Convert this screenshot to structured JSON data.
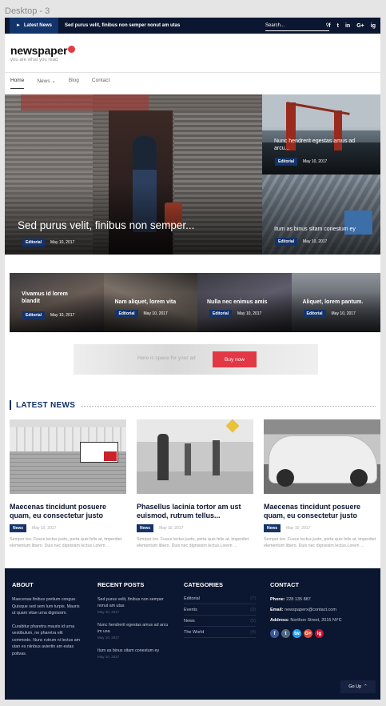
{
  "frame": {
    "label": "Desktop - 3"
  },
  "topbar": {
    "badge_label": "Latest News",
    "ticker": "Sed purus velit, finibus non semper nonut am utas",
    "search_placeholder": "Search...",
    "socials": [
      "f",
      "t",
      "in",
      "G+",
      "ig"
    ]
  },
  "logo": {
    "name": "newspaper",
    "tagline": "you are what you read"
  },
  "nav": {
    "items": [
      "Home",
      "News",
      "Blog",
      "Contact"
    ]
  },
  "hero": {
    "main": {
      "title": "Sed purus velit, finibus non semper...",
      "category": "Editorial",
      "date": "May 10, 2017"
    },
    "side": [
      {
        "title": "Nunc hendrerit egestas amus ad arcu...",
        "category": "Editorial",
        "date": "May 10, 2017"
      },
      {
        "title": "Itum as binus sitam conestum ey",
        "category": "Editorial",
        "date": "May 10, 2017"
      }
    ]
  },
  "strip": [
    {
      "title": "Vivamus id lorem blandit",
      "category": "Editorial",
      "date": "May 10, 2017"
    },
    {
      "title": "Nam aliquet, lorem vita",
      "category": "Editorial",
      "date": "May 10, 2017"
    },
    {
      "title": "Nulla nec enimus amis",
      "category": "Editorial",
      "date": "May 10, 2017"
    },
    {
      "title": "Aliquet, lorem pantum.",
      "category": "Editorial",
      "date": "May 10, 2017"
    }
  ],
  "ad": {
    "text": "Here is space for your ad",
    "button": "Buy now"
  },
  "latest": {
    "heading": "LATEST NEWS",
    "cards": [
      {
        "title": "Maecenas tincidunt posuere quam, eu consectetur justo",
        "category": "News",
        "date": "May 10, 2017",
        "excerpt": "Semper leo. Fusce lectus justo, porta quis felis at, imperdiet elementum libero. Duis nec dignissim lectus.Lorem ..."
      },
      {
        "title": "Phasellus lacinia tortor am ust euismod, rutrum tellus...",
        "category": "News",
        "date": "May 10, 2017",
        "excerpt": "Semper leo. Fusce lectus justo, porta quis felis at, imperdiet elementum libero. Duis nec dignissim lectus.Lorem ..."
      },
      {
        "title": "Maecenas tincidunt posuere quam, eu consectetur justo",
        "category": "News",
        "date": "May 10, 2017",
        "excerpt": "Semper leo. Fusce lectus justo, porta quis felis at, imperdiet elementum libero. Duis nec dignissim lectus.Lorem ..."
      }
    ]
  },
  "footer": {
    "about": {
      "heading": "ABOUT",
      "p1": "Maecenas finibus pretium congue. Quisque sed sem lum turpis. Mauris ut quam vitae urna dignissim.",
      "p2": "Curabitur pharetra mauris id urna vestibulum, ne pharetra elit commodo. Nunc rutrum ni lectus am utan es niinbus aviertin am estas potivas."
    },
    "recent": {
      "heading": "RECENT POSTS",
      "posts": [
        {
          "title": "Sed purus velit, finibus non semper nonut am utas",
          "date": "May 10, 2017"
        },
        {
          "title": "Nunc hendrerit egestas amus ad arcu im usa",
          "date": "May 10, 2017"
        },
        {
          "title": "Itum as binus sitam conestum ey",
          "date": "May 10, 2017"
        }
      ]
    },
    "categories": {
      "heading": "CATEGORIES",
      "items": [
        {
          "name": "Editorial",
          "count": "(7)"
        },
        {
          "name": "Events",
          "count": "(3)"
        },
        {
          "name": "News",
          "count": "(5)"
        },
        {
          "name": "The World",
          "count": "(4)"
        }
      ]
    },
    "contact": {
      "heading": "CONTACT",
      "phone_label": "Phone:",
      "phone": "228 135 887",
      "email_label": "Email:",
      "email": "newspaperx@contact.com",
      "address_label": "Address:",
      "address": "Northon Street, 2015 NYC",
      "socials": [
        "f",
        "t",
        "tw",
        "G+",
        "ig"
      ]
    },
    "goup": "Go Up"
  },
  "colors": {
    "navy": "#0b1630",
    "accent": "#13336b",
    "red": "#e23744"
  }
}
